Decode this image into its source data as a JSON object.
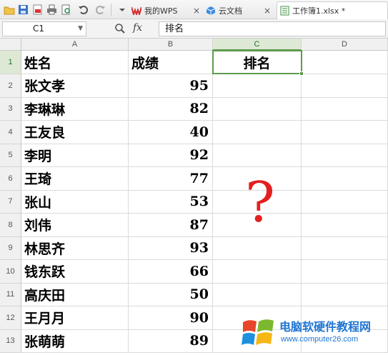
{
  "tabs": [
    {
      "label": "我的WPS",
      "close": "×"
    },
    {
      "label": "云文档",
      "close": "×"
    },
    {
      "label": "工作簿1.xlsx *"
    }
  ],
  "formula_bar": {
    "name_box": "C1",
    "fx_label": "fx",
    "content": "排名"
  },
  "columns": [
    "A",
    "B",
    "C",
    "D"
  ],
  "rows": [
    {
      "num": "1",
      "name": "姓名",
      "score": "成绩",
      "rank": "排名"
    },
    {
      "num": "2",
      "name": "张文孝",
      "score": "95",
      "rank": ""
    },
    {
      "num": "3",
      "name": "李琳琳",
      "score": "82",
      "rank": ""
    },
    {
      "num": "4",
      "name": "王友良",
      "score": "40",
      "rank": ""
    },
    {
      "num": "5",
      "name": "李明",
      "score": "92",
      "rank": ""
    },
    {
      "num": "6",
      "name": "王琦",
      "score": "77",
      "rank": ""
    },
    {
      "num": "7",
      "name": "张山",
      "score": "53",
      "rank": ""
    },
    {
      "num": "8",
      "name": "刘伟",
      "score": "87",
      "rank": ""
    },
    {
      "num": "9",
      "name": "林思齐",
      "score": "93",
      "rank": ""
    },
    {
      "num": "10",
      "name": "钱东跃",
      "score": "66",
      "rank": ""
    },
    {
      "num": "11",
      "name": "高庆田",
      "score": "50",
      "rank": ""
    },
    {
      "num": "12",
      "name": "王月月",
      "score": "90",
      "rank": ""
    },
    {
      "num": "13",
      "name": "张萌萌",
      "score": "89",
      "rank": ""
    }
  ],
  "annotation": "?",
  "watermark": {
    "title": "电脑软硬件教程网",
    "url": "www.computer26.com"
  },
  "colors": {
    "selection": "#5e9a4e",
    "question_mark": "#e32020",
    "watermark": "#1f75d3"
  }
}
